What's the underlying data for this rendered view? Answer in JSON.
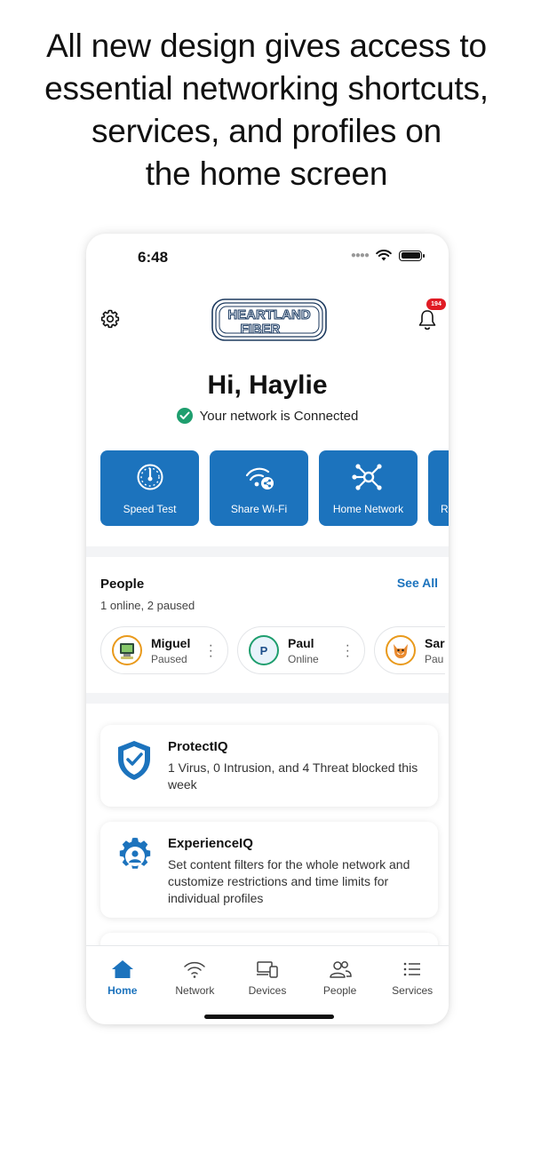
{
  "headline": {
    "line1": "All new design gives access to",
    "line2": "essential networking shortcuts,",
    "line3": "services, and profiles on",
    "line4": "the home screen"
  },
  "status_bar": {
    "time": "6:48"
  },
  "header": {
    "logo_text_top": "HEARTLAND",
    "logo_text_bottom": "FIBER",
    "notification_count": "194"
  },
  "greeting": "Hi, Haylie",
  "network_status": "Your network is Connected",
  "quick_actions": [
    {
      "label": "Speed Test",
      "icon": "speedometer-icon"
    },
    {
      "label": "Share Wi-Fi",
      "icon": "share-wifi-icon"
    },
    {
      "label": "Home Network",
      "icon": "network-hub-icon"
    },
    {
      "label": "Re",
      "icon": "unknown-icon"
    }
  ],
  "people": {
    "title": "People",
    "see_all": "See All",
    "summary": "1 online, 2 paused",
    "profiles": [
      {
        "name": "Miguel",
        "state": "Paused"
      },
      {
        "name": "Paul",
        "state": "Online",
        "initial": "P"
      },
      {
        "name": "Sar",
        "state": "Pau"
      }
    ]
  },
  "cards": [
    {
      "title": "ProtectIQ",
      "description": "1 Virus, 0 Intrusion, and 4 Threat blocked this week",
      "icon": "shield-check-icon"
    },
    {
      "title": "ExperienceIQ",
      "description": "Set content filters for the whole network and customize restrictions and time limits for individual profiles",
      "icon": "gear-person-icon"
    }
  ],
  "tabs": [
    {
      "label": "Home",
      "icon": "home-icon",
      "active": true
    },
    {
      "label": "Network",
      "icon": "wifi-icon"
    },
    {
      "label": "Devices",
      "icon": "devices-icon"
    },
    {
      "label": "People",
      "icon": "people-icon"
    },
    {
      "label": "Services",
      "icon": "list-icon"
    }
  ],
  "colors": {
    "primary": "#1c73bd",
    "success": "#1e9e6e",
    "badge": "#e01b24"
  }
}
